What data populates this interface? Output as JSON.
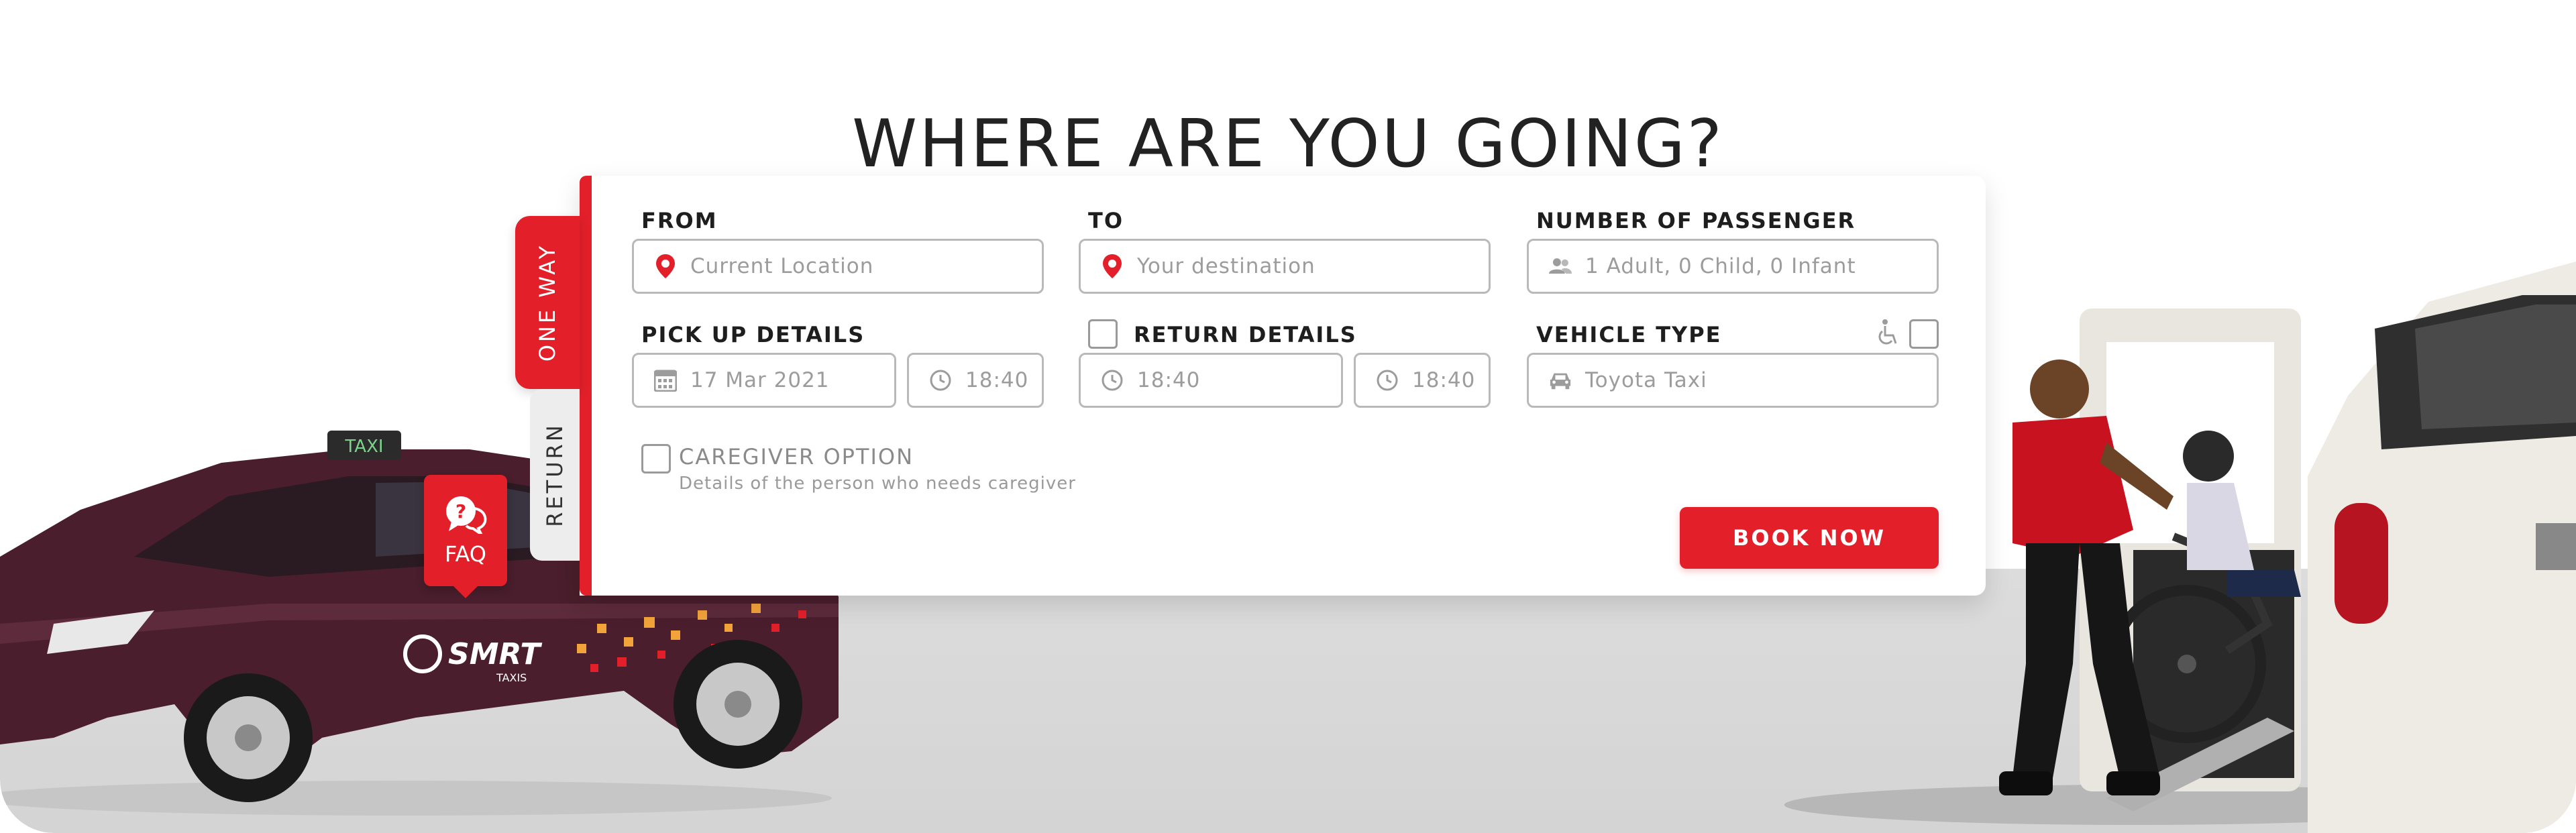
{
  "page": {
    "title": "WHERE ARE YOU GOING?"
  },
  "tabs": {
    "one_way": "ONE WAY",
    "return": "RETURN"
  },
  "form": {
    "from": {
      "label": "FROM",
      "placeholder": "Current Location",
      "icon": "map-pin-icon"
    },
    "to": {
      "label": "TO",
      "placeholder": "Your destination",
      "icon": "map-pin-icon"
    },
    "passengers": {
      "label": "NUMBER OF PASSENGER",
      "value": "1 Adult, 0 Child, 0 Infant",
      "icon": "users-icon"
    },
    "pickup": {
      "label": "PICK UP DETAILS",
      "date": "17 Mar 2021",
      "time": "18:40"
    },
    "return": {
      "label": "RETURN DETAILS",
      "date_time": "18:40",
      "time": "18:40"
    },
    "vehicle": {
      "label": "VEHICLE TYPE",
      "value": "Toyota Taxi",
      "icon": "car-icon",
      "wheelchair_icon": "wheelchair-icon"
    },
    "caregiver": {
      "label": "CAREGIVER OPTION",
      "description": "Details of the person who needs caregiver"
    },
    "book_button": "BOOK NOW"
  },
  "faq": {
    "label": "FAQ"
  },
  "illustrations": {
    "left": "smrt-taxi",
    "taxi_roof_sign": "TAXI",
    "taxi_brand": "SMRT",
    "taxi_subbrand": "TAXIS",
    "right": "wheelchair-boarding-taxi"
  },
  "colors": {
    "accent": "#e3202a",
    "text": "#222222",
    "muted": "#9c9c9c",
    "border": "#b9b9b9",
    "car_body": "#4a1e2c"
  }
}
